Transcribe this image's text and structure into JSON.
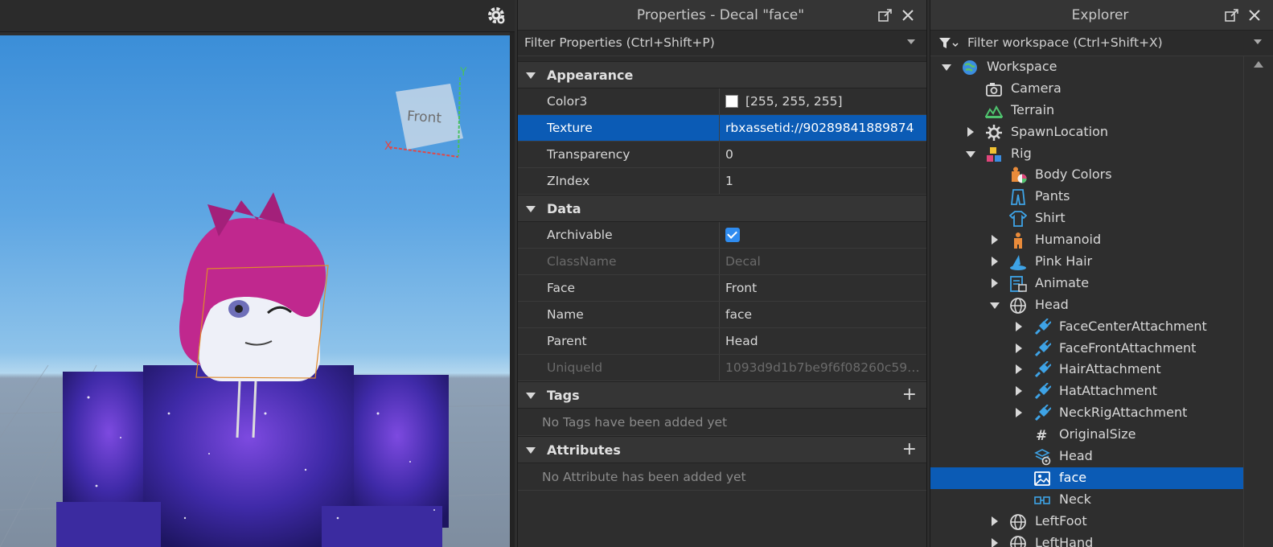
{
  "viewport": {
    "view_cube_label": "Front",
    "axis_x": "X",
    "axis_y": "Y",
    "settings_icon": "gear-icon"
  },
  "properties": {
    "title": "Properties - Decal \"face\"",
    "filter_placeholder": "Filter Properties (Ctrl+Shift+P)",
    "sections": {
      "appearance": {
        "label": "Appearance",
        "rows": [
          {
            "name": "Color3",
            "value": "[255, 255, 255]",
            "swatch": "#ffffff"
          },
          {
            "name": "Texture",
            "value": "rbxassetid://90289841889874",
            "selected": true
          },
          {
            "name": "Transparency",
            "value": "0"
          },
          {
            "name": "ZIndex",
            "value": "1"
          }
        ]
      },
      "data": {
        "label": "Data",
        "rows": [
          {
            "name": "Archivable",
            "value": "",
            "checked": true
          },
          {
            "name": "ClassName",
            "value": "Decal",
            "disabled": true
          },
          {
            "name": "Face",
            "value": "Front"
          },
          {
            "name": "Name",
            "value": "face"
          },
          {
            "name": "Parent",
            "value": "Head"
          },
          {
            "name": "UniqueId",
            "value": "1093d9d1b7be9f6f08260c590...",
            "disabled": true
          }
        ]
      },
      "tags": {
        "label": "Tags",
        "empty": "No Tags have been added yet"
      },
      "attributes": {
        "label": "Attributes",
        "empty": "No Attribute has been added yet"
      }
    }
  },
  "explorer": {
    "title": "Explorer",
    "filter_placeholder": "Filter workspace (Ctrl+Shift+X)",
    "tree": [
      {
        "label": "Workspace",
        "depth": 0,
        "arrow": "down",
        "icon": "globe-workspace-icon"
      },
      {
        "label": "Camera",
        "depth": 1,
        "arrow": "",
        "icon": "camera-icon"
      },
      {
        "label": "Terrain",
        "depth": 1,
        "arrow": "",
        "icon": "terrain-icon"
      },
      {
        "label": "SpawnLocation",
        "depth": 1,
        "arrow": "right",
        "icon": "spawn-location-icon"
      },
      {
        "label": "Rig",
        "depth": 1,
        "arrow": "down",
        "icon": "model-icon"
      },
      {
        "label": "Body Colors",
        "depth": 2,
        "arrow": "",
        "icon": "body-colors-icon"
      },
      {
        "label": "Pants",
        "depth": 2,
        "arrow": "",
        "icon": "pants-icon"
      },
      {
        "label": "Shirt",
        "depth": 2,
        "arrow": "",
        "icon": "shirt-icon"
      },
      {
        "label": "Humanoid",
        "depth": 2,
        "arrow": "right",
        "icon": "humanoid-icon"
      },
      {
        "label": "Pink Hair",
        "depth": 2,
        "arrow": "right",
        "icon": "accessory-hat-icon"
      },
      {
        "label": "Animate",
        "depth": 2,
        "arrow": "right",
        "icon": "script-icon"
      },
      {
        "label": "Head",
        "depth": 2,
        "arrow": "down",
        "icon": "mesh-part-icon"
      },
      {
        "label": "FaceCenterAttachment",
        "depth": 3,
        "arrow": "right",
        "icon": "attachment-icon"
      },
      {
        "label": "FaceFrontAttachment",
        "depth": 3,
        "arrow": "right",
        "icon": "attachment-icon"
      },
      {
        "label": "HairAttachment",
        "depth": 3,
        "arrow": "right",
        "icon": "attachment-icon"
      },
      {
        "label": "HatAttachment",
        "depth": 3,
        "arrow": "right",
        "icon": "attachment-icon"
      },
      {
        "label": "NeckRigAttachment",
        "depth": 3,
        "arrow": "right",
        "icon": "attachment-icon"
      },
      {
        "label": "OriginalSize",
        "depth": 3,
        "arrow": "",
        "icon": "number-value-icon"
      },
      {
        "label": "Head",
        "depth": 3,
        "arrow": "",
        "icon": "special-mesh-icon"
      },
      {
        "label": "face",
        "depth": 3,
        "arrow": "",
        "icon": "decal-icon",
        "selected": true
      },
      {
        "label": "Neck",
        "depth": 3,
        "arrow": "",
        "icon": "motor6d-icon"
      },
      {
        "label": "LeftFoot",
        "depth": 2,
        "arrow": "right",
        "icon": "mesh-part-icon"
      },
      {
        "label": "LeftHand",
        "depth": 2,
        "arrow": "right",
        "icon": "mesh-part-icon"
      }
    ]
  }
}
